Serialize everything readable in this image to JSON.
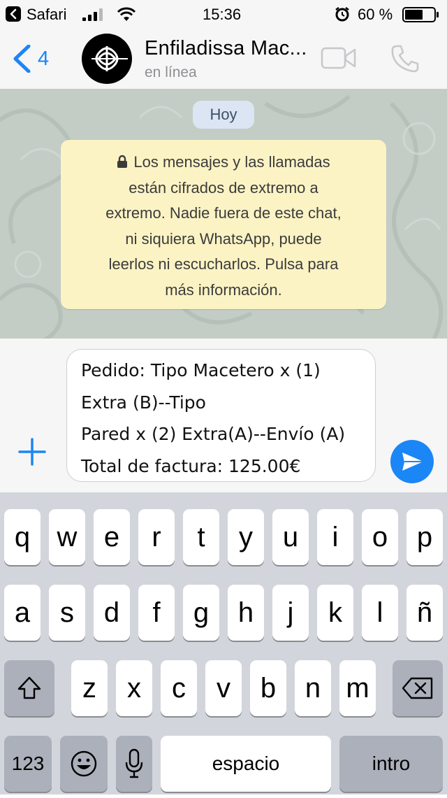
{
  "status_bar": {
    "carrier": "Safari",
    "time": "15:36",
    "battery": "60 %"
  },
  "header": {
    "back_count": "4",
    "contact_name": "Enfiladissa Mac...",
    "status": "en línea",
    "icons": [
      "back-chevron-icon",
      "video-camera-icon",
      "phone-icon"
    ]
  },
  "chat": {
    "date": "Hoy",
    "encryption_notice": [
      "Los mensajes y las llamadas",
      "están cifrados de extremo a",
      "extremo. Nadie fuera de este chat,",
      "ni siquiera WhatsApp, puede",
      "leerlos ni escucharlos. Pulsa para",
      "más información."
    ]
  },
  "composer": {
    "message_lines": [
      "Pedido: Tipo Macetero x (1)",
      "Extra (B)--Tipo",
      "Pared x (2) Extra(A)--Envío (A)",
      "Total de factura: 125.00€"
    ]
  },
  "keyboard": {
    "row1": [
      "q",
      "w",
      "e",
      "r",
      "t",
      "y",
      "u",
      "i",
      "o",
      "p"
    ],
    "row2": [
      "a",
      "s",
      "d",
      "f",
      "g",
      "h",
      "j",
      "k",
      "l",
      "ñ"
    ],
    "row3": [
      "z",
      "x",
      "c",
      "v",
      "b",
      "n",
      "m"
    ],
    "numbers_key": "123",
    "space_key": "espacio",
    "return_key": "intro"
  },
  "colors": {
    "accent": "#1b86f5",
    "notice_bg": "#fcf3c4",
    "date_pill_bg": "#dbe5f4",
    "wallpaper": "#c3cdc6"
  }
}
